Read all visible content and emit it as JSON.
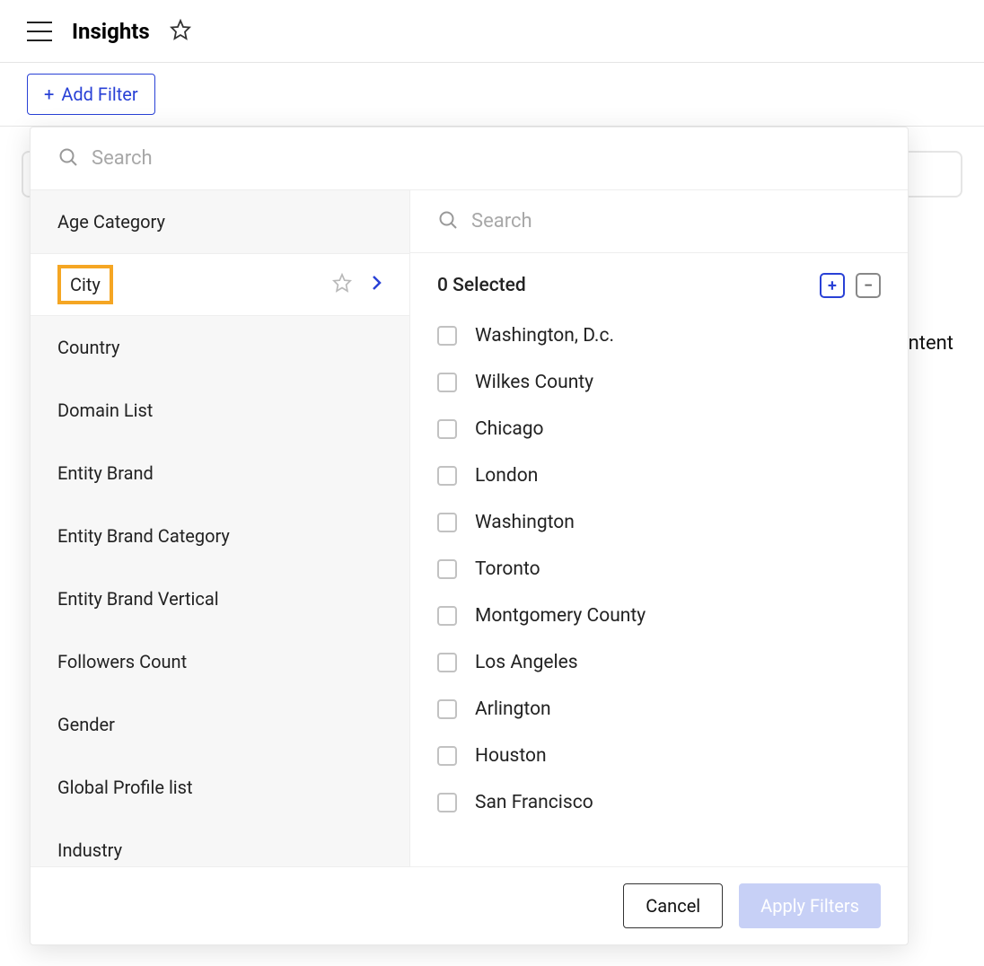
{
  "header": {
    "title": "Insights"
  },
  "filter_bar": {
    "add_filter_label": "Add Filter"
  },
  "background": {
    "column_partial": "ontent"
  },
  "popup": {
    "main_search_placeholder": "Search",
    "categories": {
      "items": [
        {
          "label": "Age Category"
        },
        {
          "label": "City"
        },
        {
          "label": "Country"
        },
        {
          "label": "Domain List"
        },
        {
          "label": "Entity Brand"
        },
        {
          "label": "Entity Brand Category"
        },
        {
          "label": "Entity Brand Vertical"
        },
        {
          "label": "Followers Count"
        },
        {
          "label": "Gender"
        },
        {
          "label": "Global Profile list"
        },
        {
          "label": "Industry"
        }
      ],
      "selected_index": 1
    },
    "values": {
      "search_placeholder": "Search",
      "selected_text": "0 Selected",
      "options": [
        "Washington, D.c.",
        "Wilkes County",
        "Chicago",
        "London",
        "Washington",
        "Toronto",
        "Montgomery County",
        "Los Angeles",
        "Arlington",
        "Houston",
        "San Francisco"
      ]
    },
    "footer": {
      "cancel_label": "Cancel",
      "apply_label": "Apply Filters"
    }
  }
}
